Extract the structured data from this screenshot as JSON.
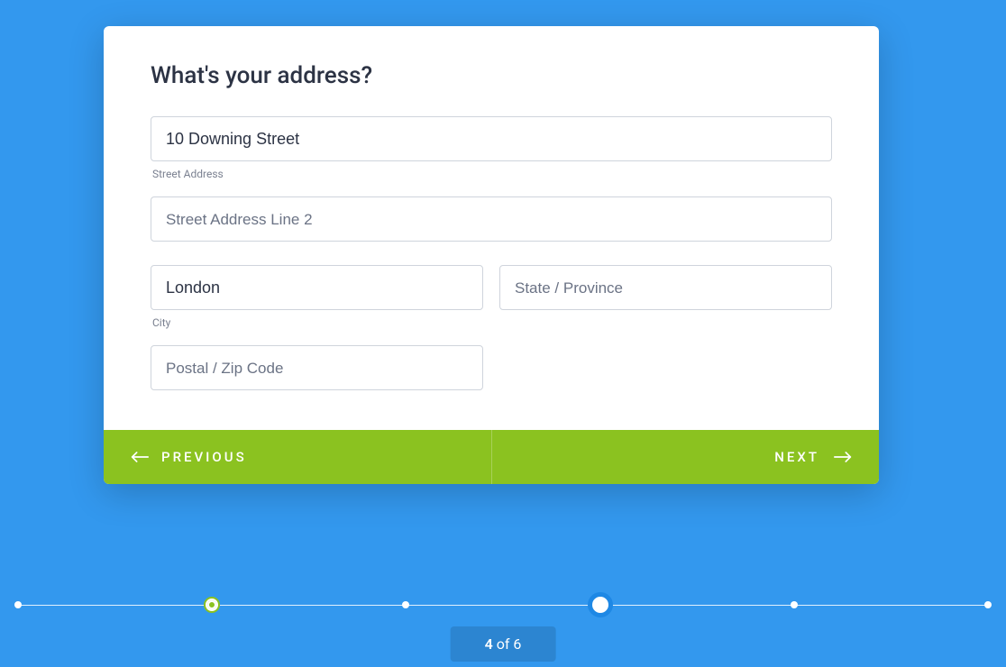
{
  "form": {
    "title": "What's your address?",
    "fields": {
      "street": {
        "value": "10 Downing Street",
        "sublabel": "Street Address"
      },
      "street2": {
        "placeholder": "Street Address Line 2"
      },
      "city": {
        "value": "London",
        "sublabel": "City"
      },
      "state": {
        "placeholder": "State / Province"
      },
      "postal": {
        "placeholder": "Postal / Zip Code"
      }
    }
  },
  "nav": {
    "previous": "PREVIOUS",
    "next": "NEXT"
  },
  "progress": {
    "current": 4,
    "total": 6,
    "of_text": " of ",
    "steps": [
      {
        "state": "past"
      },
      {
        "state": "completed"
      },
      {
        "state": "past"
      },
      {
        "state": "current"
      },
      {
        "state": "future"
      },
      {
        "state": "future"
      }
    ]
  },
  "colors": {
    "background": "#3398ee",
    "accent": "#8bc220",
    "ring": "#1e88e5"
  }
}
